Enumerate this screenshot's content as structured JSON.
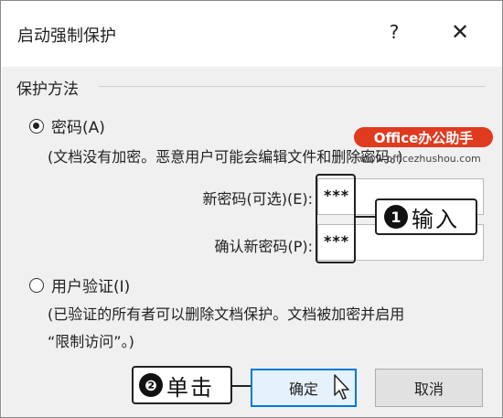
{
  "dialog": {
    "title": "启动强制保护",
    "help_label": "?",
    "close_label": "✕"
  },
  "group": {
    "title": "保护方法"
  },
  "password_option": {
    "label": "密码(A)",
    "checked": true,
    "description": "(文档没有加密。恶意用户可能会编辑文件和删除密码。)"
  },
  "fields": {
    "new_password_label": "新密码(可选)(E):",
    "new_password_value": "***",
    "confirm_password_label": "确认新密码(P):",
    "confirm_password_value": "***"
  },
  "user_auth_option": {
    "label": "用户验证(I)",
    "checked": false,
    "description_line1": "(已验证的所有者可以删除文档保护。文档被加密并启用",
    "description_line2": "“限制访问”。)"
  },
  "buttons": {
    "ok_label": "确定",
    "cancel_label": "取消"
  },
  "annotations": {
    "step1_number": "1",
    "step1_text": "输入",
    "step2_number": "❷",
    "step2_text": "单击"
  },
  "watermark": {
    "brand": "Office办公助手",
    "url": "www.officezhushou.com"
  },
  "colors": {
    "accent": "#0078d7",
    "watermark_red": "#e03a1f",
    "client_bg": "#f0f0f0"
  }
}
